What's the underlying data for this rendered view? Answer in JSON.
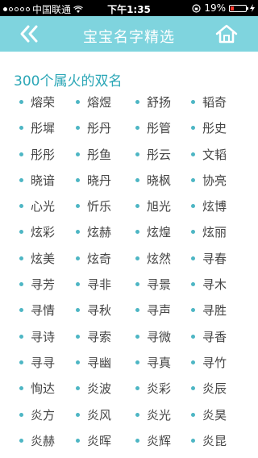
{
  "status": {
    "carrier": "中国联通",
    "time": "下午1:35",
    "battery": "19%"
  },
  "nav": {
    "title": "宝宝名字精选"
  },
  "section": {
    "title": "300个属火的双名"
  },
  "names": [
    [
      "熔荣",
      "熔煜",
      "舒扬",
      "韬奇"
    ],
    [
      "彤墀",
      "彤丹",
      "彤管",
      "彤史"
    ],
    [
      "彤彤",
      "彤鱼",
      "彤云",
      "文韬"
    ],
    [
      "晓谙",
      "晓丹",
      "晓枫",
      "协亮"
    ],
    [
      "心光",
      "忻乐",
      "旭光",
      "炫博"
    ],
    [
      "炫彩",
      "炫赫",
      "炫煌",
      "炫丽"
    ],
    [
      "炫美",
      "炫奇",
      "炫然",
      "寻春"
    ],
    [
      "寻芳",
      "寻非",
      "寻景",
      "寻木"
    ],
    [
      "寻情",
      "寻秋",
      "寻声",
      "寻胜"
    ],
    [
      "寻诗",
      "寻索",
      "寻微",
      "寻香"
    ],
    [
      "寻寻",
      "寻幽",
      "寻真",
      "寻竹"
    ],
    [
      "恂达",
      "炎波",
      "炎彩",
      "炎辰"
    ],
    [
      "炎方",
      "炎风",
      "炎光",
      "炎昊"
    ],
    [
      "炎赫",
      "炎晖",
      "炎辉",
      "炎昆"
    ]
  ]
}
